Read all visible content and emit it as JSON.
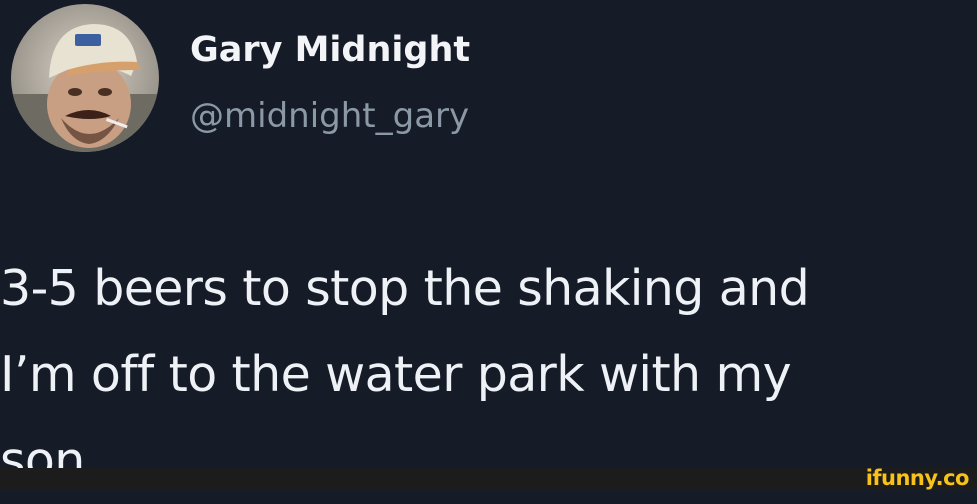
{
  "tweet": {
    "display_name": "Gary Midnight",
    "handle": "@midnight_gary",
    "text": "3-5 beers to stop the shaking and\nI’m off to the water park with my\nson"
  },
  "watermark": {
    "text": "ifunny.co"
  },
  "icons": {
    "avatar": "profile-photo"
  },
  "colors": {
    "background": "#151b27",
    "primary_text": "#eef1f5",
    "secondary_text": "#8b98a5",
    "watermark": "#f7c21a",
    "footer": "#1c1c1c"
  }
}
